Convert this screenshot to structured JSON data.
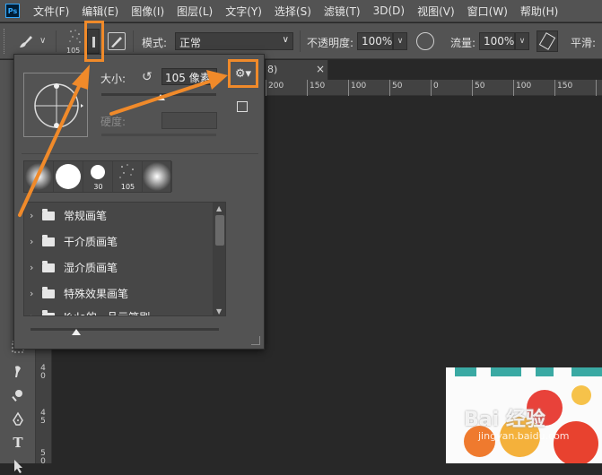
{
  "app": {
    "logo_text": "Ps"
  },
  "menu": [
    "文件(F)",
    "编辑(E)",
    "图像(I)",
    "图层(L)",
    "文字(Y)",
    "选择(S)",
    "滤镜(T)",
    "3D(D)",
    "视图(V)",
    "窗口(W)",
    "帮助(H)"
  ],
  "options": {
    "brush_size_num": "105",
    "mode_label": "模式:",
    "mode_value": "正常",
    "opacity_label": "不透明度:",
    "opacity_value": "100%",
    "flow_label": "流量:",
    "flow_value": "100%",
    "smooth_label": "平滑:"
  },
  "doc": {
    "tab_close": "×",
    "tab_partial": "8)",
    "ruler_labels": [
      "200",
      "150",
      "100",
      "50",
      "0",
      "50",
      "100",
      "150",
      "200"
    ],
    "vruler_labels": [
      "4\n0",
      "4\n5",
      "5\n0"
    ]
  },
  "brush_panel": {
    "size_label": "大小:",
    "size_value": "105 像素",
    "hardness_label": "硬度:",
    "gear_label": "⚙▾",
    "recent_sizes": [
      "",
      "",
      "30",
      "105",
      ""
    ],
    "groups": [
      "常规画笔",
      "干介质画笔",
      "湿介质画笔",
      "特殊效果画笔",
      "Kyle的...品示笔刷"
    ]
  },
  "watermark": {
    "brand": "Bai 经验",
    "url": "jingyan.baidu.com"
  },
  "colors": {
    "accent_highlight": "#f08a2a",
    "teal_stripe": "#3aa9a3"
  }
}
